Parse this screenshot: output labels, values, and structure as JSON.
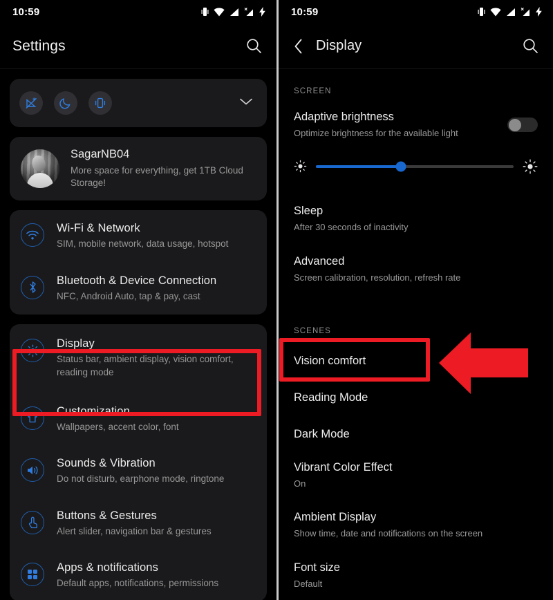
{
  "left": {
    "statusbar": {
      "time": "10:59",
      "icons": [
        "vibrate-icon",
        "wifi-icon",
        "signal-icon",
        "signal-no-sim-icon",
        "charging-bolt-icon"
      ]
    },
    "appbar": {
      "title": "Settings",
      "search_icon": "search-icon"
    },
    "quick_settings": {
      "toggles": [
        "airplane-mode-off-icon",
        "night-mode-icon",
        "vibrate-mode-icon"
      ],
      "expand_icon": "chevron-down-icon"
    },
    "account": {
      "name": "SagarNB04",
      "subtitle": "More space for everything, get 1TB Cloud Storage!",
      "avatar": "user-photo-avatar"
    },
    "items": [
      {
        "title": "Wi-Fi & Network",
        "subtitle": "SIM, mobile network, data usage, hotspot",
        "icon": "wifi-icon"
      },
      {
        "title": "Bluetooth & Device Connection",
        "subtitle": "NFC, Android Auto, tap & pay, cast",
        "icon": "bluetooth-icon"
      },
      {
        "title": "Display",
        "subtitle": "Status bar, ambient display, vision comfort, reading mode",
        "icon": "brightness-icon",
        "highlighted": true
      },
      {
        "title": "Customization",
        "subtitle": "Wallpapers, accent color, font",
        "icon": "tshirt-icon"
      },
      {
        "title": "Sounds & Vibration",
        "subtitle": "Do not disturb, earphone mode, ringtone",
        "icon": "speaker-icon"
      },
      {
        "title": "Buttons & Gestures",
        "subtitle": "Alert slider, navigation bar & gestures",
        "icon": "gesture-tap-icon"
      },
      {
        "title": "Apps & notifications",
        "subtitle": "Default apps, notifications, permissions",
        "icon": "apps-grid-icon"
      }
    ]
  },
  "right": {
    "statusbar": {
      "time": "10:59",
      "icons": [
        "vibrate-icon",
        "wifi-icon",
        "signal-icon",
        "signal-no-sim-icon",
        "charging-bolt-icon"
      ]
    },
    "appbar": {
      "back_icon": "back-chevron-icon",
      "title": "Display",
      "search_icon": "search-icon"
    },
    "sections": [
      {
        "label": "SCREEN",
        "items": [
          {
            "title": "Adaptive brightness",
            "subtitle": "Optimize brightness for the available light",
            "toggle": "off"
          },
          {
            "type": "slider",
            "value_percent": 43,
            "left_icon": "brightness-low-icon",
            "right_icon": "brightness-high-icon"
          },
          {
            "title": "Sleep",
            "subtitle": "After 30 seconds of inactivity"
          },
          {
            "title": "Advanced",
            "subtitle": "Screen calibration, resolution, refresh rate"
          }
        ]
      },
      {
        "label": "SCENES",
        "items": [
          {
            "title": "Vision comfort",
            "subtitle": "",
            "highlighted": true
          },
          {
            "title": "Reading Mode",
            "subtitle": ""
          },
          {
            "title": "Dark Mode",
            "subtitle": ""
          },
          {
            "title": "Vibrant Color Effect",
            "subtitle": "On"
          },
          {
            "title": "Ambient Display",
            "subtitle": "Show time, date and notifications on the screen"
          },
          {
            "title": "Font size",
            "subtitle": "Default"
          }
        ]
      }
    ]
  },
  "annotations": {
    "highlight_color": "#ed1c24",
    "arrow_color": "#ed1c24",
    "display_box": "display-row-highlight",
    "vision_comfort_box": "vision-comfort-highlight",
    "arrow": "pointer-arrow-left"
  },
  "colors": {
    "background": "#000000",
    "card": "#1a1a1c",
    "accent_blue": "#1868cf",
    "icon_outline_blue": "#1f5fb0",
    "primary_text": "#ececec",
    "secondary_text": "#9a9a9a"
  }
}
